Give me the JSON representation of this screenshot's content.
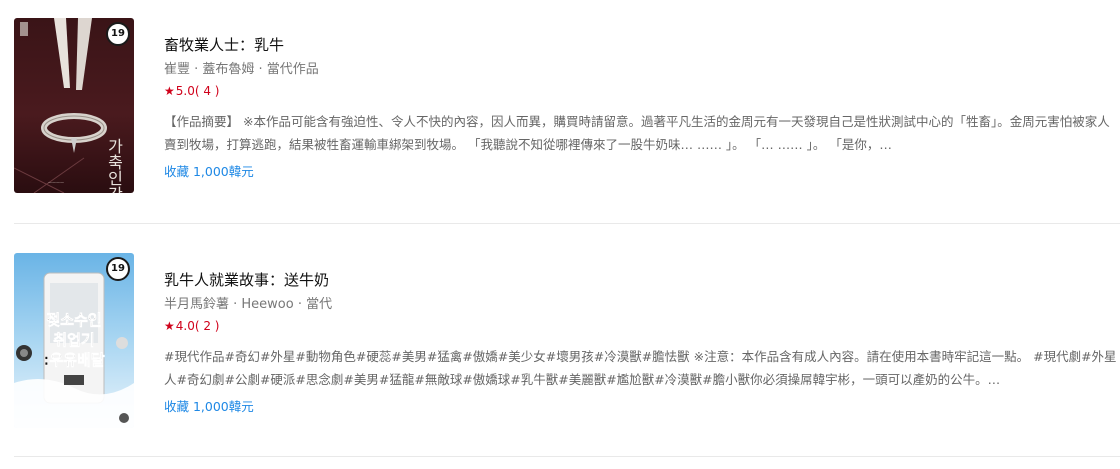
{
  "items": [
    {
      "age_badge": "19",
      "cover_text": "가축인간",
      "title": "畜牧業人士：乳牛",
      "author": "崔豐 · 蓋布魯姆 · 當代作品",
      "rating_star": "★",
      "rating_value": "5.0",
      "rating_count": "( 4 )",
      "description": "【作品摘要】 ※本作品可能含有強迫性、令人不快的內容，因人而異，購買時請留意。過著平凡生活的金周元有一天發現自己是性狀測試中心的「牲畜」。金周元害怕被家人賣到牧場，打算逃跑，結果被牲畜運輸車綁架到牧場。 「我聽說不知從哪裡傳來了一股牛奶味… …… 」。 「… …… 」。 「是你，…",
      "price": "收藏 1,000韓元"
    },
    {
      "age_badge": "19",
      "cover_text": "젖소수인 취업기 :우유배달",
      "title": "乳牛人就業故事：送牛奶",
      "author": "半月馬鈴薯 · Heewoo · 當代",
      "rating_star": "★",
      "rating_value": "4.0",
      "rating_count": "( 2 )",
      "description": "#現代作品#奇幻#外星#動物角色#硬蕊#美男#猛禽#傲嬌#美少女#壞男孩#冷漠獸#膽怯獸 ※注意：本作品含有成人內容。請在使用本書時牢記這一點。 #現代劇#外星人#奇幻劇#公劇#硬派#思念劇#美男#猛龍#無敵球#傲嬌球#乳牛獸#美麗獸#尷尬獸#冷漠獸#膽小獸你必須操屌韓宇彬，一頭可以產奶的公牛。…",
      "price": "收藏 1,000韓元"
    }
  ],
  "colors": {
    "rating": "#d0021b",
    "price_link": "#1e88e5",
    "meta_text": "#777777",
    "divider": "#e9e9e9"
  }
}
